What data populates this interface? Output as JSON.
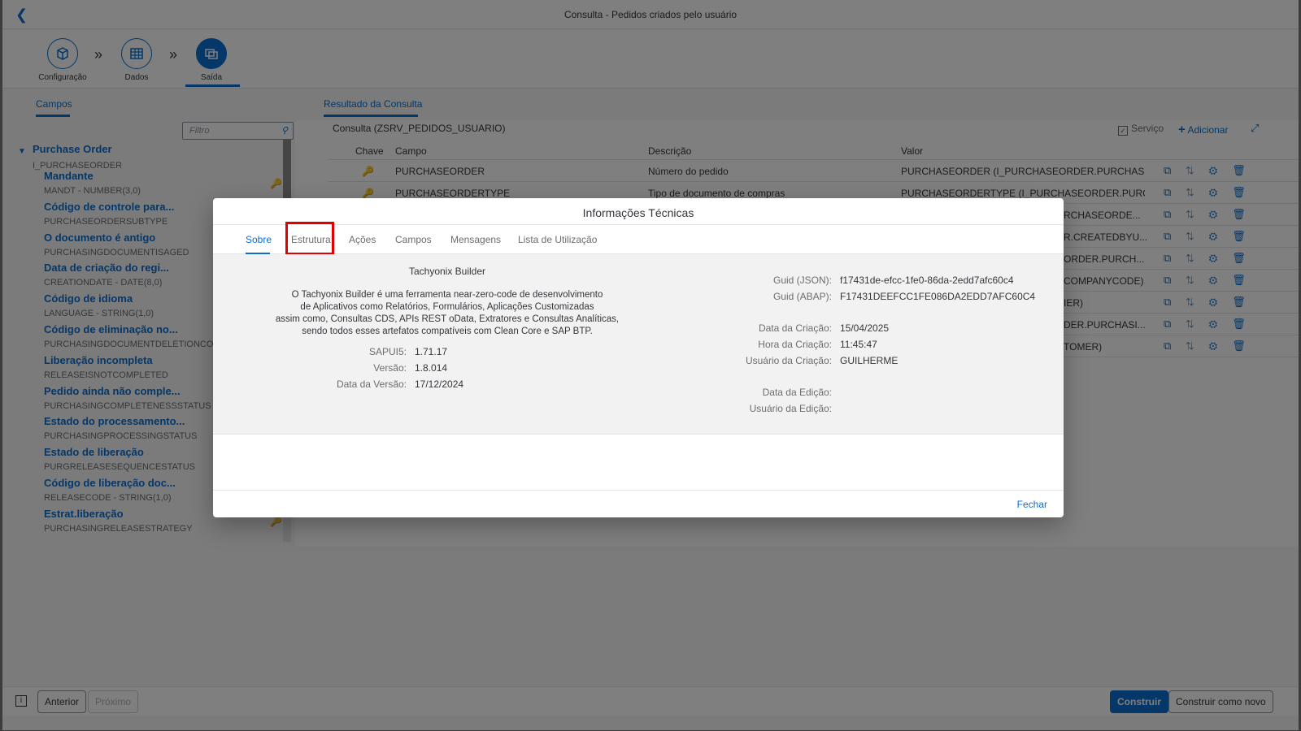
{
  "app": {
    "title": "Consulta - Pedidos criados pelo usuário"
  },
  "wizard": {
    "steps": [
      {
        "label": "Configuração",
        "icon": "cube-icon"
      },
      {
        "label": "Dados",
        "icon": "table-icon"
      },
      {
        "label": "Saída",
        "icon": "output-icon"
      }
    ]
  },
  "left": {
    "tab": "Campos",
    "filter_placeholder": "Filtro",
    "root": {
      "name": "Purchase Order",
      "tech": "I_PURCHASEORDER"
    },
    "fields": [
      {
        "name": "Mandante",
        "tech": "MANDT - NUMBER(3,0)"
      },
      {
        "name": "Código de controle para...",
        "tech": "PURCHASEORDERSUBTYPE"
      },
      {
        "name": "O documento é antigo",
        "tech": "PURCHASINGDOCUMENTISAGED"
      },
      {
        "name": "Data de criação do regi...",
        "tech": "CREATIONDATE - DATE(8,0)"
      },
      {
        "name": "Código de idioma",
        "tech": "LANGUAGE - STRING(1,0)"
      },
      {
        "name": "Código de eliminação no...",
        "tech": "PURCHASINGDOCUMENTDELETIONCOD"
      },
      {
        "name": "Liberação incompleta",
        "tech": "RELEASEISNOTCOMPLETED"
      },
      {
        "name": "Pedido ainda não comple...",
        "tech": "PURCHASINGCOMPLETENESSSTATUS"
      },
      {
        "name": "Estado do processamento...",
        "tech": "PURCHASINGPROCESSINGSTATUS"
      },
      {
        "name": "Estado de liberação",
        "tech": "PURGRELEASESEQUENCESTATUS"
      },
      {
        "name": "Código de liberação doc...",
        "tech": "RELEASECODE - STRING(1,0)"
      },
      {
        "name": "Estrat.liberação",
        "tech": "PURCHASINGRELEASESTRATEGY"
      }
    ]
  },
  "right": {
    "tab": "Resultado da Consulta",
    "consulta_title": "Consulta (ZSRV_PEDIDOS_USUARIO)",
    "servico_label": "Serviço",
    "add_label": "Adicionar",
    "columns": [
      "Chave",
      "Campo",
      "Descrição",
      "Valor"
    ],
    "rows": [
      {
        "campo": "PURCHASEORDER",
        "descricao": "Número do pedido",
        "valor": "PURCHASEORDER (I_PURCHASEORDER.PURCHASEO..."
      },
      {
        "campo": "PURCHASEORDERTYPE",
        "descricao": "Tipo de documento de compras",
        "valor": "PURCHASEORDERTYPE (I_PURCHASEORDER.PURCH..."
      },
      {
        "campo": "",
        "descricao": "",
        "valor": "RCHASEORDE..."
      },
      {
        "campo": "",
        "descricao": "",
        "valor": "R.CREATEDBYU..."
      },
      {
        "campo": "",
        "descricao": "",
        "valor": "ORDER.PURCH..."
      },
      {
        "campo": "",
        "descricao": "",
        "valor": "COMPANYCODE)"
      },
      {
        "campo": "",
        "descricao": "",
        "valor": "IER)"
      },
      {
        "campo": "",
        "descricao": "",
        "valor": "DER.PURCHASI..."
      },
      {
        "campo": "",
        "descricao": "",
        "valor": "TOMER)"
      }
    ]
  },
  "footer": {
    "prev": "Anterior",
    "next": "Próximo",
    "build": "Construir",
    "build_as": "Construir como novo"
  },
  "dialog": {
    "title": "Informações Técnicas",
    "tabs": [
      "Sobre",
      "Estrutura",
      "Ações",
      "Campos",
      "Mensagens",
      "Lista de Utilização"
    ],
    "product": "Tachyonix Builder",
    "description": [
      "O Tachyonix Builder é uma ferramenta near-zero-code de desenvolvimento",
      "de Aplicativos como Relatórios, Formulários, Aplicações Customizadas",
      "assim como, Consultas CDS, APIs REST oData, Extratores e Consultas Analíticas,",
      "sendo todos esses artefatos compatíveis com Clean Core e SAP BTP."
    ],
    "left_info": [
      {
        "k": "SAPUI5:",
        "v": "1.71.17"
      },
      {
        "k": "Versão:",
        "v": "1.8.014"
      },
      {
        "k": "Data da Versão:",
        "v": "17/12/2024"
      }
    ],
    "right_info": [
      {
        "k": "Guid (JSON):",
        "v": "f17431de-efcc-1fe0-86da-2edd7afc60c4"
      },
      {
        "k": "Guid (ABAP):",
        "v": "F17431DEEFCC1FE086DA2EDD7AFC60C4"
      },
      {
        "k": "Data da Criação:",
        "v": "15/04/2025"
      },
      {
        "k": "Hora da Criação:",
        "v": "11:45:47"
      },
      {
        "k": "Usuário da Criação:",
        "v": "GUILHERME"
      },
      {
        "k": "Data da Edição:",
        "v": ""
      },
      {
        "k": "Usuário da Edição:",
        "v": ""
      }
    ],
    "close": "Fechar"
  }
}
